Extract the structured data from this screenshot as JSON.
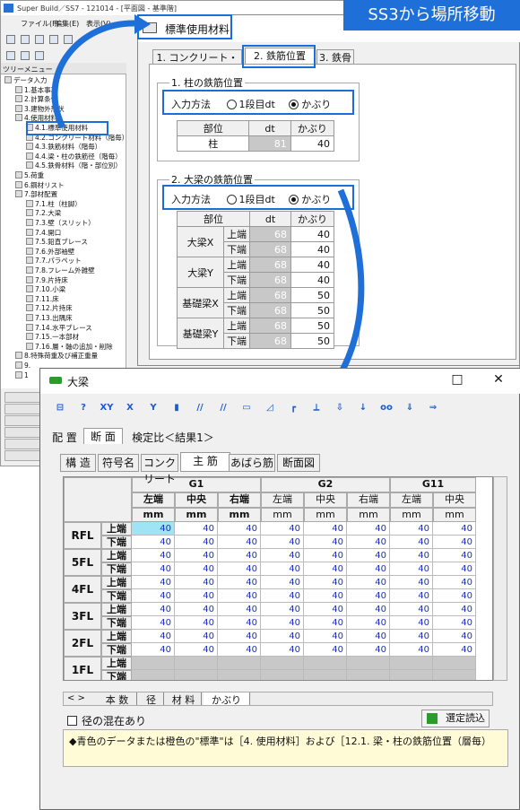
{
  "main_window": {
    "title": "Super Build／SS7 - 121014 - [平面図 - 基準階]",
    "menu": [
      "ファイル(F)",
      "編集(E)",
      "表示(V)"
    ],
    "tree_title": "ツリーメニュー",
    "tree": [
      "データ入力",
      "1.基本事項",
      "2.計算条件",
      "3.建物外形状",
      "4.使用材料",
      "4.1.標準使用材料",
      "4.2.コンクリート材料（階毎）",
      "4.3.鉄筋材料（階毎）",
      "4.4.梁・柱の鉄筋径（階毎）",
      "4.5.鉄骨材料（階・部位別）",
      "5.荷重",
      "6.鋼材リスト",
      "7.部材配置",
      "7.1.柱（柱脚）",
      "7.2.大梁",
      "7.3.壁（スリット）",
      "7.4.開口",
      "7.5.鉛直ブレース",
      "7.6.外部袖壁",
      "7.7.パラペット",
      "7.8.フレーム外雑壁",
      "7.9.片持床",
      "7.10.小梁",
      "7.11.床",
      "7.12.片持床",
      "7.13.出隅床",
      "7.14.水平ブレース",
      "7.15.一本部材",
      "7.16.層・軸の追加・削除",
      "8.特殊荷重及び補正重量",
      "9.",
      "1"
    ],
    "side_buttons": [
      "精",
      "精",
      "精",
      "精",
      "精",
      "精"
    ]
  },
  "banner": "SS3から場所移動",
  "std_window": {
    "title": "標準使用材料",
    "tabs": [
      "1. コンクリート・鉄筋",
      "2. 鉄筋位置",
      "3. 鉄骨"
    ],
    "group1": {
      "label": "1. 柱の鉄筋位置",
      "method_label": "入力方法",
      "opt1": "1段目dt",
      "opt2": "かぶり",
      "headers": [
        "部位",
        "dt",
        "かぶり"
      ],
      "rows": [
        [
          "柱",
          "81",
          "40"
        ]
      ]
    },
    "group2": {
      "label": "2. 大梁の鉄筋位置",
      "method_label": "入力方法",
      "opt1": "1段目dt",
      "opt2": "かぶり",
      "headers": [
        "部位",
        "dt",
        "かぶり"
      ],
      "rows": [
        [
          "大梁X",
          "上端",
          "68",
          "40"
        ],
        [
          "",
          "下端",
          "68",
          "40"
        ],
        [
          "大梁Y",
          "上端",
          "68",
          "40"
        ],
        [
          "",
          "下端",
          "68",
          "40"
        ],
        [
          "基礎梁X",
          "上端",
          "68",
          "50"
        ],
        [
          "",
          "下端",
          "68",
          "50"
        ],
        [
          "基礎梁Y",
          "上端",
          "68",
          "50"
        ],
        [
          "",
          "下端",
          "68",
          "50"
        ]
      ]
    }
  },
  "beam_window": {
    "title": "大梁",
    "controls": [
      "□",
      "✕"
    ],
    "tools": [
      "⊟",
      "?",
      "XY",
      "X",
      "Y",
      "▮",
      "//",
      "//",
      "▭",
      "◿",
      "┏",
      "⟂",
      "⇩",
      "↓",
      "oo",
      "⇓",
      "⇒"
    ],
    "sheet_tabs": [
      "配 置",
      "断 面",
      "検定比＜結果1＞"
    ],
    "sub_tabs": [
      "構 造",
      "符号名",
      "コンクリート",
      "主 筋",
      "あばら筋",
      "断面図"
    ],
    "columns": [
      {
        "name": "G1",
        "subs": [
          "左端",
          "中央",
          "右端"
        ]
      },
      {
        "name": "G2",
        "subs": [
          "左端",
          "中央",
          "右端"
        ]
      },
      {
        "name": "G11",
        "subs": [
          "左端",
          "中央"
        ]
      }
    ],
    "unit": "mm",
    "floors": [
      {
        "name": "RFL",
        "upper": "上端",
        "lower": "下端"
      },
      {
        "name": "5FL",
        "upper": "上端",
        "lower": "下端"
      },
      {
        "name": "4FL",
        "upper": "上端",
        "lower": "下端"
      },
      {
        "name": "3FL",
        "upper": "上端",
        "lower": "下端"
      },
      {
        "name": "2FL",
        "upper": "上端",
        "lower": "下端"
      },
      {
        "name": "1FL",
        "upper": "上端",
        "lower": "下端"
      }
    ],
    "cell_value": "40",
    "bottom_tabs": [
      "本 数",
      "径",
      "材 料",
      "かぶり"
    ],
    "nav": "< >",
    "checkbox": "径の混在あり",
    "read_button": "選定読込",
    "info": "◆青色のデータまたは橙色の\"標準\"は［4. 使用材料］および［12.1. 梁・柱の鉄筋位置（層毎）"
  }
}
